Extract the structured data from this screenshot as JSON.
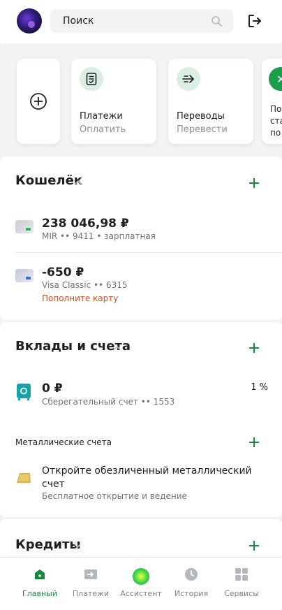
{
  "header": {
    "search_placeholder": "Поиск",
    "icons": [
      "avatar",
      "search-icon",
      "logout-icon"
    ]
  },
  "quick_actions": {
    "items": [
      {
        "title": "Платежи",
        "subtitle": "Оплатить",
        "icon": "payment-doc-icon"
      },
      {
        "title": "Переводы",
        "subtitle": "Перевести",
        "icon": "transfer-arrow-icon"
      },
      {
        "title_lines": [
          "По",
          "ста",
          "по"
        ],
        "icon": "partial-service-icon"
      }
    ]
  },
  "wallet": {
    "title": "Кошелёк",
    "accounts": [
      {
        "amount": "238 046,98 ₽",
        "details": "MIR •• 9411 • зарплатная",
        "card_color": "green"
      },
      {
        "amount": "-650 ₽",
        "details": "Visa Classic •• 6315",
        "warning": "Пополните карту",
        "card_color": "blue"
      }
    ]
  },
  "deposits": {
    "title": "Вклады и счета",
    "savings": {
      "amount": "0 ₽",
      "details": "Сберегательный счет •• 1553",
      "rate": "1 %"
    },
    "metal_label": "Металлические счета",
    "metal_offer": {
      "title": "Откройте обезличенный металлический счет",
      "subtitle": "Бесплатное открытие и ведение"
    }
  },
  "credits": {
    "title": "Кредиты"
  },
  "nav": {
    "items": [
      {
        "label": "Главный",
        "active": true
      },
      {
        "label": "Платежи"
      },
      {
        "label": "Ассистент"
      },
      {
        "label": "История"
      },
      {
        "label": "Сервисы"
      }
    ]
  },
  "colors": {
    "accent": "#16883f",
    "warning": "#d14f1b",
    "bg": "#f2f3f5"
  }
}
